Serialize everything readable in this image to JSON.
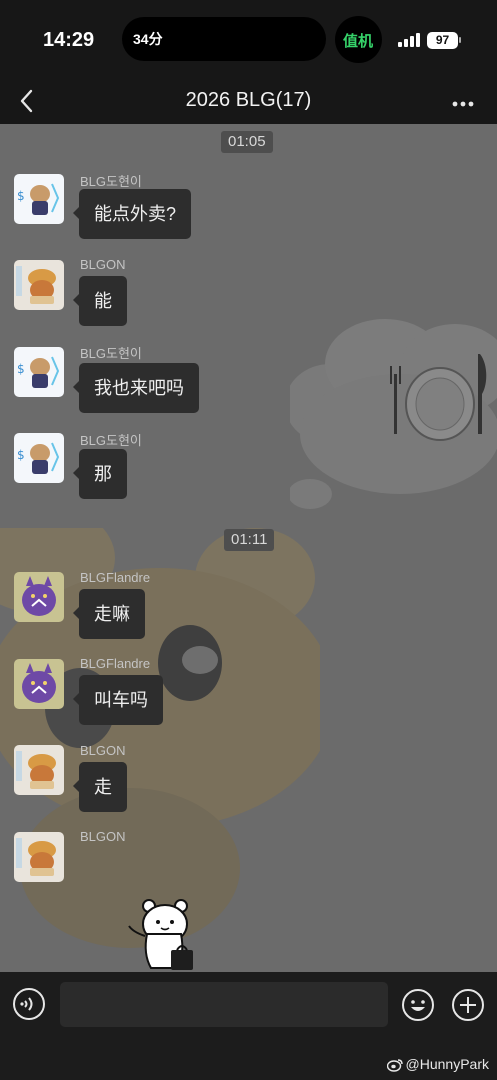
{
  "status_bar": {
    "time": "14:29",
    "island_text": "34分",
    "app_badge": "值机",
    "battery": "97"
  },
  "header": {
    "title": "2026 BLG(17)"
  },
  "chat": {
    "timestamps": [
      "01:05",
      "01:11"
    ],
    "messages": [
      {
        "sender": "BLG도현이",
        "text": "能点外卖?"
      },
      {
        "sender": "BLGON",
        "text": "能"
      },
      {
        "sender": "BLG도현이",
        "text": "我也来吧吗"
      },
      {
        "sender": "BLG도현이",
        "text": "那"
      },
      {
        "sender": "BLGFlandre",
        "text": "走嘛"
      },
      {
        "sender": "BLGFlandre",
        "text": "叫车吗"
      },
      {
        "sender": "BLGON",
        "text": "走"
      },
      {
        "sender": "BLGON",
        "text": ""
      }
    ]
  },
  "input": {
    "value": "",
    "placeholder": ""
  },
  "watermark": "@HunnyPark",
  "icons": {
    "back": "chevron-left-icon",
    "more": "more-dots-icon",
    "voice": "voice-icon",
    "emoji": "emoji-icon",
    "plus": "plus-icon"
  },
  "colors": {
    "bar_bg": "#171717",
    "chat_bg": "#6b6b6b",
    "bubble_bg": "#2d2d2d",
    "badge_green": "#36d36a"
  }
}
